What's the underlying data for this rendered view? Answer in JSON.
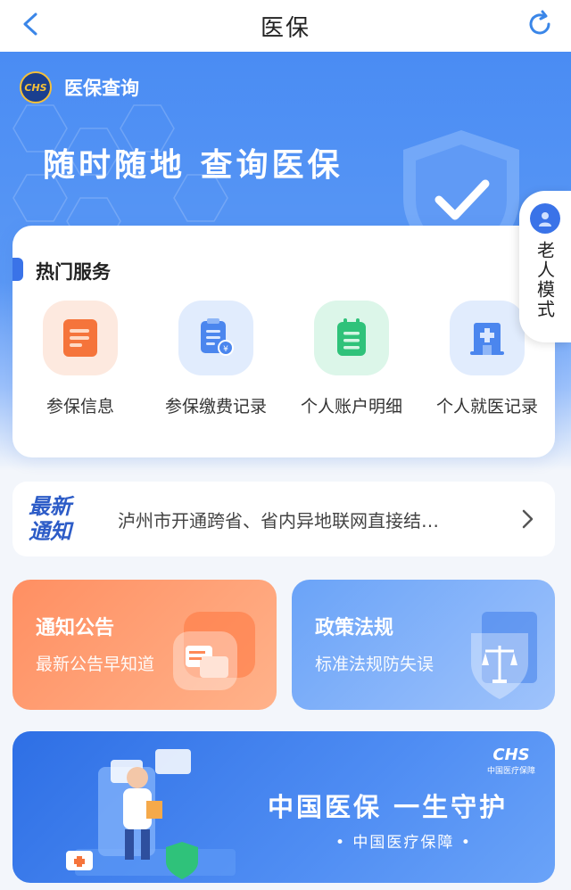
{
  "header": {
    "title": "医保"
  },
  "hero": {
    "brand_logo_text": "CHS",
    "brand_name": "医保查询",
    "slogan": "随时随地  查询医保"
  },
  "elder_mode": {
    "label": "老人模式"
  },
  "hot_services": {
    "heading": "热门服务",
    "items": [
      {
        "label": "参保信息",
        "icon": "document-icon",
        "color": "#f5743b"
      },
      {
        "label": "参保缴费记录",
        "icon": "payment-record-icon",
        "color": "#3a7be8"
      },
      {
        "label": "个人账户明细",
        "icon": "clipboard-icon",
        "color": "#2fc27a"
      },
      {
        "label": "个人就医记录",
        "icon": "hospital-icon",
        "color": "#3a7be8"
      }
    ]
  },
  "news": {
    "tag_line1": "最新",
    "tag_line2": "通知",
    "text": "泸州市开通跨省、省内异地联网直接结…"
  },
  "cards": {
    "notice": {
      "title": "通知公告",
      "subtitle": "最新公告早知道"
    },
    "policy": {
      "title": "政策法规",
      "subtitle": "标准法规防失误"
    }
  },
  "banner": {
    "logo_mark": "CHS",
    "logo_cn": "中国医疗保障",
    "main": "中国医保  一生守护",
    "sub": "• 中国医疗保障 •"
  }
}
